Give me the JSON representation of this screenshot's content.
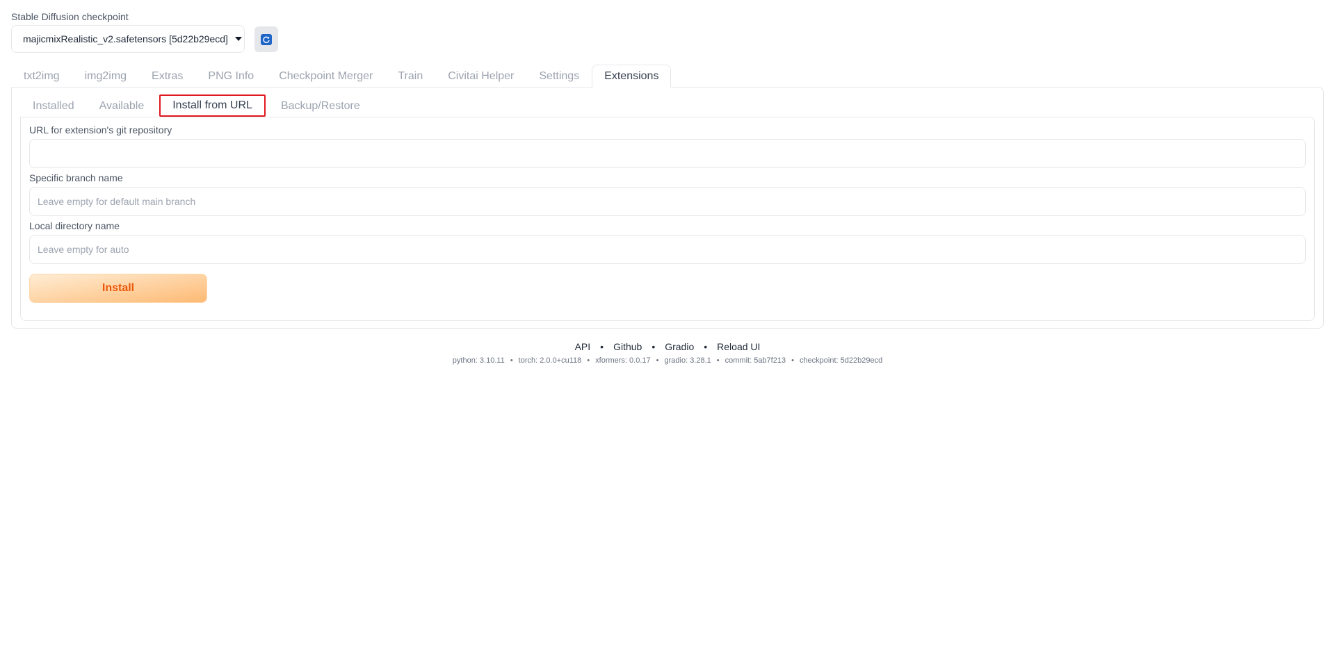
{
  "checkpoint": {
    "label": "Stable Diffusion checkpoint",
    "value": "majicmixRealistic_v2.safetensors [5d22b29ecd]"
  },
  "top_tabs": [
    {
      "label": "txt2img"
    },
    {
      "label": "img2img"
    },
    {
      "label": "Extras"
    },
    {
      "label": "PNG Info"
    },
    {
      "label": "Checkpoint Merger"
    },
    {
      "label": "Train"
    },
    {
      "label": "Civitai Helper"
    },
    {
      "label": "Settings"
    },
    {
      "label": "Extensions",
      "active": true
    }
  ],
  "sub_tabs": [
    {
      "label": "Installed"
    },
    {
      "label": "Available"
    },
    {
      "label": "Install from URL",
      "active": true
    },
    {
      "label": "Backup/Restore"
    }
  ],
  "form": {
    "url_label": "URL for extension's git repository",
    "url_value": "",
    "branch_label": "Specific branch name",
    "branch_placeholder": "Leave empty for default main branch",
    "dir_label": "Local directory name",
    "dir_placeholder": "Leave empty for auto",
    "install_label": "Install"
  },
  "footer": {
    "links": [
      "API",
      "Github",
      "Gradio",
      "Reload UI"
    ],
    "separator": "•",
    "info": [
      "python: 3.10.11",
      "torch: 2.0.0+cu118",
      "xformers: 0.0.17",
      "gradio: 3.28.1",
      "commit: 5ab7f213",
      "checkpoint: 5d22b29ecd"
    ]
  },
  "colors": {
    "highlight_border": "#e0191f",
    "install_text": "#ea580c",
    "refresh_icon": "#1f66c7"
  },
  "icons": {
    "refresh": "refresh-icon",
    "dropdown": "chevron-down-icon"
  }
}
